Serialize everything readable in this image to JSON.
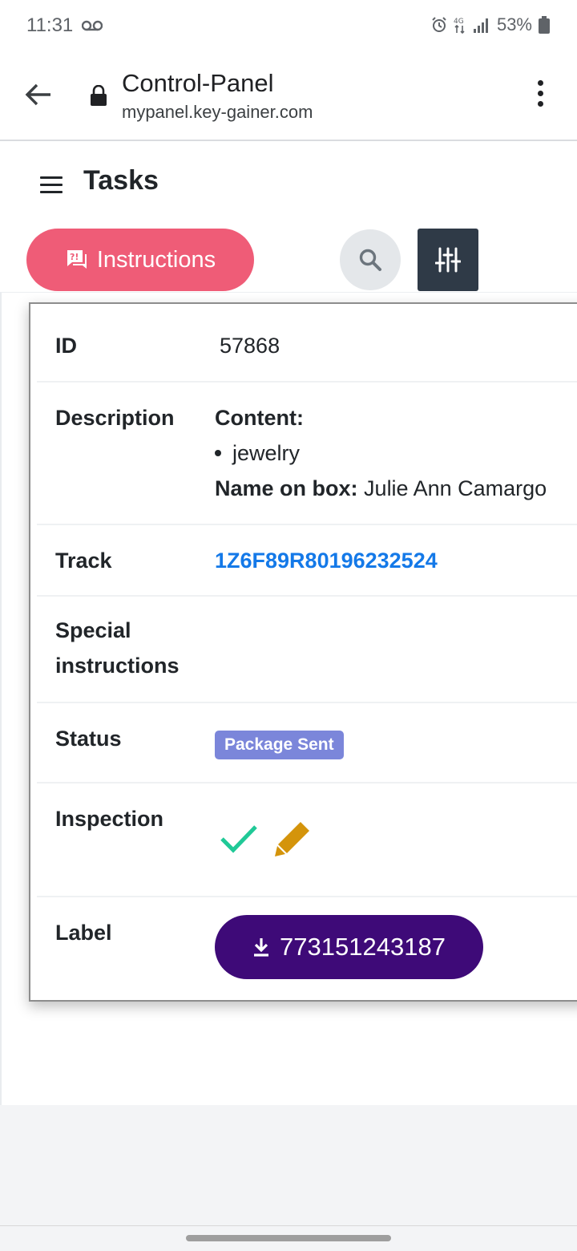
{
  "status_bar": {
    "time": "11:31",
    "battery": "53%"
  },
  "browser": {
    "title": "Control-Panel",
    "url": "mypanel.key-gainer.com"
  },
  "page": {
    "title": "Tasks",
    "instructions_label": "Instructions"
  },
  "task": {
    "id_label": "ID",
    "id_value": "57868",
    "description_label": "Description",
    "content_label": "Content:",
    "content_item": "jewelry",
    "name_on_box_label": "Name on box:",
    "name_on_box_value": "Julie Ann Camargo",
    "track_label": "Track",
    "track_value": "1Z6F89R80196232524",
    "special_label_line1": "Special",
    "special_label_line2": "instructions",
    "status_label": "Status",
    "status_value": "Package Sent",
    "inspection_label": "Inspection",
    "label_label": "Label",
    "label_button": "773151243187"
  },
  "colors": {
    "instructions_button": "#ef5c77",
    "status_badge": "#7b86da",
    "track_link": "#1479e8",
    "label_button": "#3e0a78",
    "check": "#20c997",
    "pencil": "#d4940b"
  }
}
